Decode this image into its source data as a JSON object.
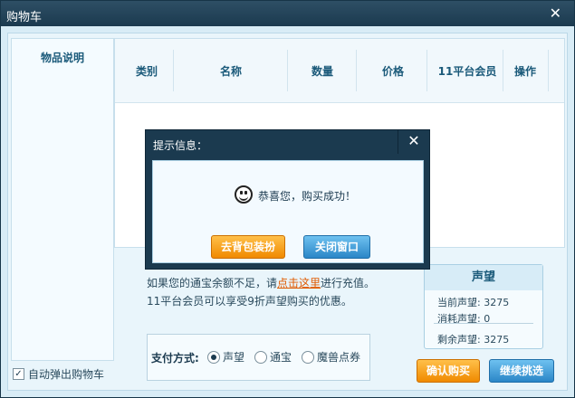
{
  "window": {
    "title": "购物车"
  },
  "left_panel": {
    "heading": "物品说明"
  },
  "table": {
    "headers": [
      "类别",
      "名称",
      "数量",
      "价格",
      "11平台会员",
      "操作"
    ]
  },
  "info": {
    "line1_prefix": "如果您的通宝余额不足，请",
    "line1_link": "点击这里",
    "line1_suffix": "进行充值。",
    "line2": "11平台会员可以享受9折声望购买的优惠。"
  },
  "reputation": {
    "title": "声望",
    "current_label": "当前声望:",
    "current_value": "3275",
    "cost_label": "消耗声望:",
    "cost_value": "0",
    "remaining_label": "剩余声望:",
    "remaining_value": "3275"
  },
  "payment": {
    "label": "支付方式:",
    "options": [
      {
        "label": "声望",
        "selected": true
      },
      {
        "label": "通宝",
        "selected": false
      },
      {
        "label": "魔兽点券",
        "selected": false
      }
    ]
  },
  "auto_popup": {
    "label": "自动弹出购物车",
    "checked": true
  },
  "buttons": {
    "confirm": "确认购买",
    "continue": "继续挑选"
  },
  "dialog": {
    "title": "提示信息：",
    "message": "恭喜您，购买成功！",
    "go_bag": "去背包装扮",
    "close": "关闭窗口"
  },
  "colors": {
    "titlebar": "#1b3a4f",
    "accent_orange": "#f08a00",
    "accent_blue": "#2b86c7"
  }
}
